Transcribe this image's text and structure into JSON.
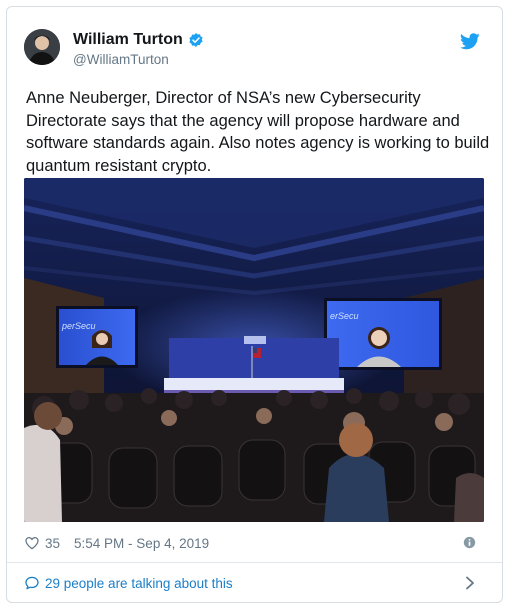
{
  "tweet": {
    "display_name": "William Turton",
    "handle": "@WilliamTurton",
    "text": "Anne Neuberger, Director of NSA’s new Cybersecurity Directorate says that the agency will propose hardware and software standards again. Also notes agency is working to build quantum resistant crypto.",
    "likes": "35",
    "timestamp": "5:54 PM - Sep 4, 2019",
    "talking": "29 people are talking about this",
    "verified": true
  },
  "media": {
    "screen_left_text": "perSecu",
    "screen_right_text": "erSecu"
  },
  "icons": {
    "brand": "twitter-bird-icon",
    "verified": "verified-badge-icon",
    "like": "heart-icon",
    "info": "info-icon",
    "talk": "speech-bubble-icon",
    "more": "chevron-right-icon"
  },
  "colors": {
    "brand_blue": "#1da1f2",
    "link_blue": "#1b7fc8",
    "secondary_text": "#657786"
  }
}
